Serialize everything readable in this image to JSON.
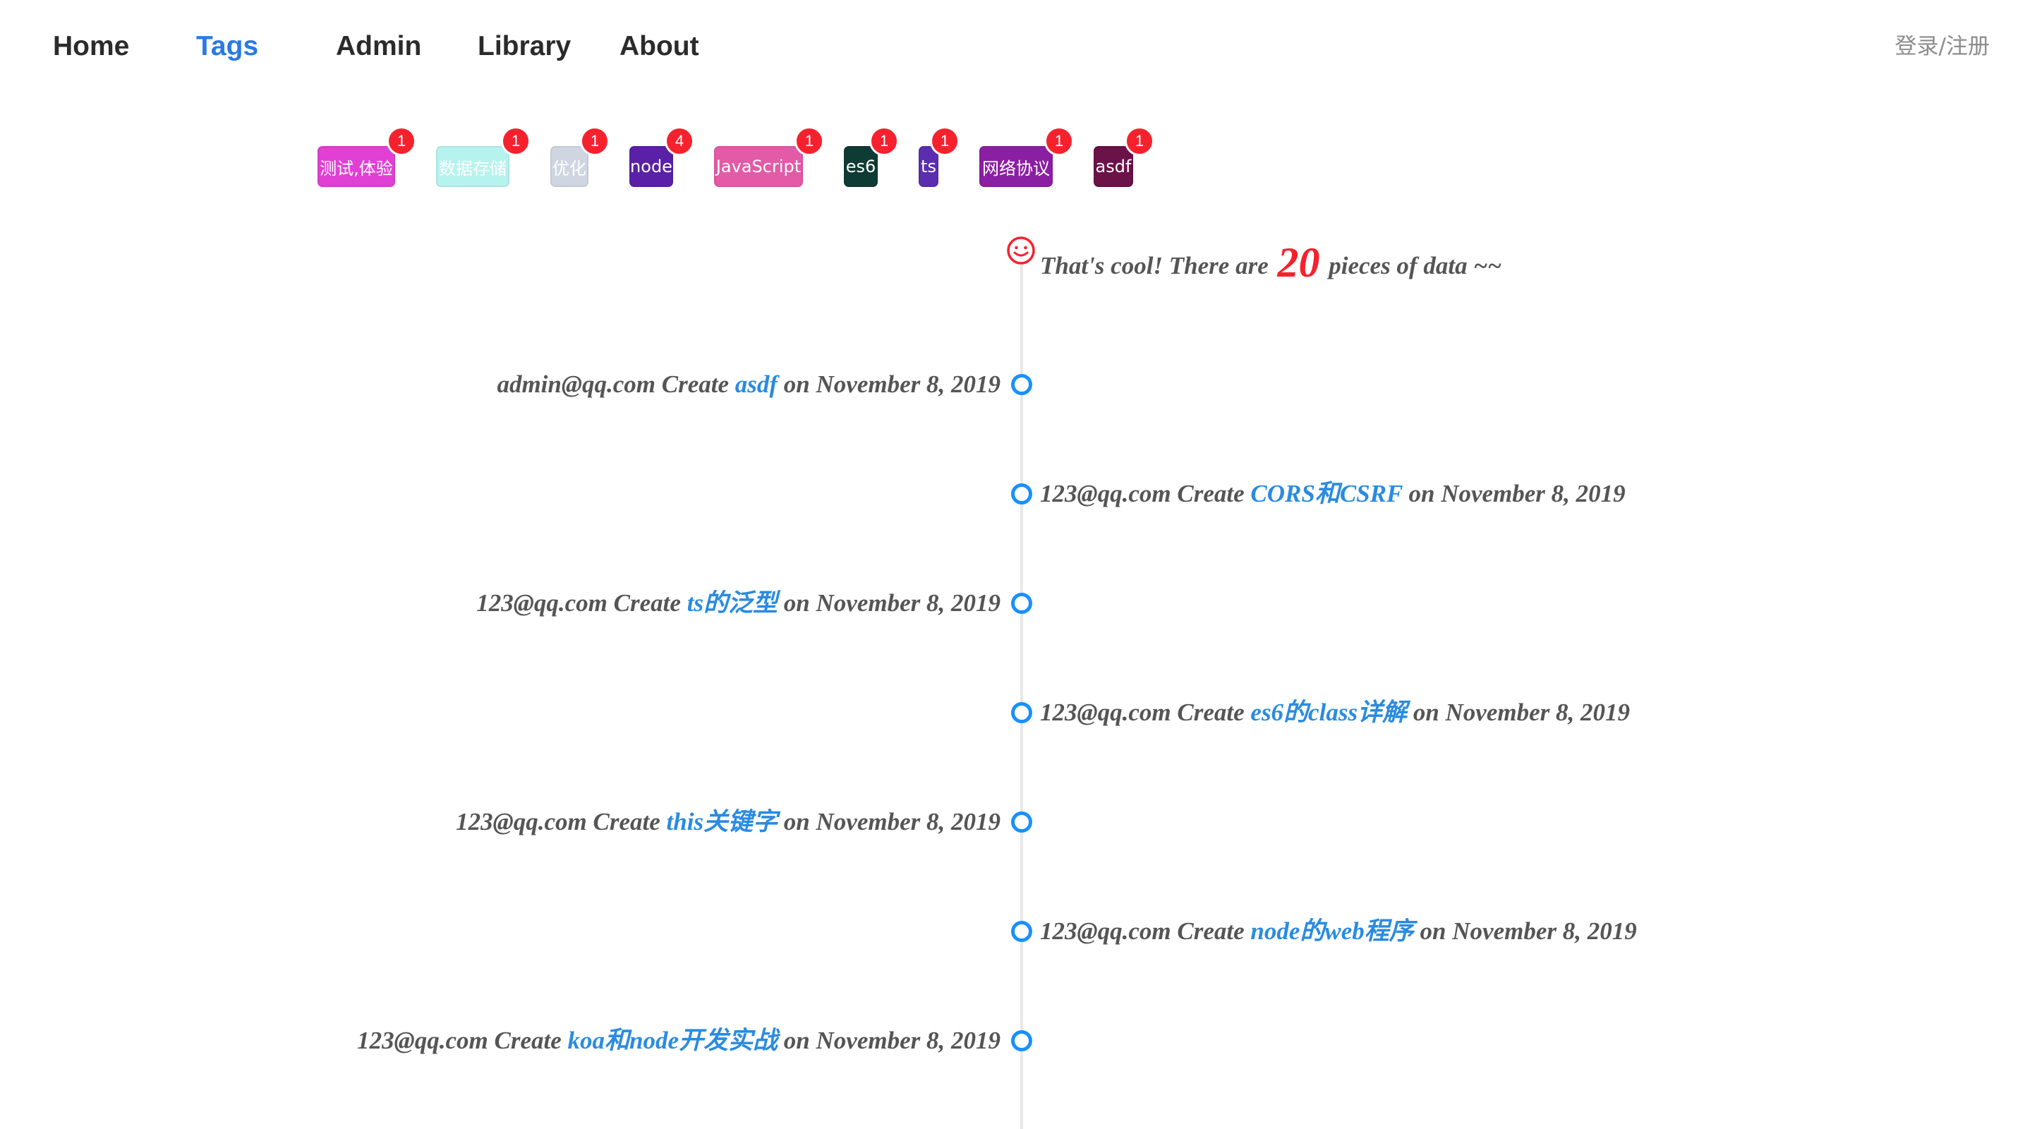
{
  "nav": {
    "items": [
      {
        "label": "Home",
        "active": false
      },
      {
        "label": "Tags",
        "active": true
      },
      {
        "label": "Admin",
        "active": false
      },
      {
        "label": "Library",
        "active": false
      },
      {
        "label": "About",
        "active": false
      }
    ],
    "login_label": "登录/注册"
  },
  "tags": [
    {
      "label": "测试,体验",
      "count": "1",
      "color": "#e040d4"
    },
    {
      "label": "数据存储",
      "count": "1",
      "color": "#b6f3ee"
    },
    {
      "label": "优化",
      "count": "1",
      "color": "#cfd6e1"
    },
    {
      "label": "node",
      "count": "4",
      "color": "#5a20a8"
    },
    {
      "label": "JavaScript",
      "count": "1",
      "color": "#e35aa6"
    },
    {
      "label": "es6",
      "count": "1",
      "color": "#0e3b33"
    },
    {
      "label": "ts",
      "count": "1",
      "color": "#5b2eb0"
    },
    {
      "label": "网络协议",
      "count": "1",
      "color": "#8b1fa3"
    },
    {
      "label": "asdf",
      "count": "1",
      "color": "#6b1248"
    }
  ],
  "timeline": {
    "summary_prefix": "That's cool! There are ",
    "count": "20",
    "summary_suffix": " pieces of data ~~",
    "entries": [
      {
        "user": "admin@qq.com",
        "verb": " Create ",
        "title": "asdf",
        "date_prefix": " on ",
        "date": "November 8, 2019",
        "side": "left"
      },
      {
        "user": "123@qq.com",
        "verb": " Create ",
        "title": "CORS和CSRF",
        "date_prefix": " on ",
        "date": "November 8, 2019",
        "side": "right"
      },
      {
        "user": "123@qq.com",
        "verb": " Create ",
        "title": "ts的泛型",
        "date_prefix": " on ",
        "date": "November 8, 2019",
        "side": "left"
      },
      {
        "user": "123@qq.com",
        "verb": " Create ",
        "title": "es6的class详解",
        "date_prefix": " on ",
        "date": "November 8, 2019",
        "side": "right"
      },
      {
        "user": "123@qq.com",
        "verb": " Create ",
        "title": "this关键字",
        "date_prefix": " on ",
        "date": "November 8, 2019",
        "side": "left"
      },
      {
        "user": "123@qq.com",
        "verb": " Create ",
        "title": "node的web程序",
        "date_prefix": " on ",
        "date": "November 8, 2019",
        "side": "right"
      },
      {
        "user": "123@qq.com",
        "verb": " Create ",
        "title": "koa和node开发实战",
        "date_prefix": " on ",
        "date": "November 8, 2019",
        "side": "left"
      }
    ]
  },
  "colors": {
    "accent": "#2a7ae2",
    "link": "#2a8be0",
    "badge": "#f5222d",
    "dot": "#1890ff"
  }
}
